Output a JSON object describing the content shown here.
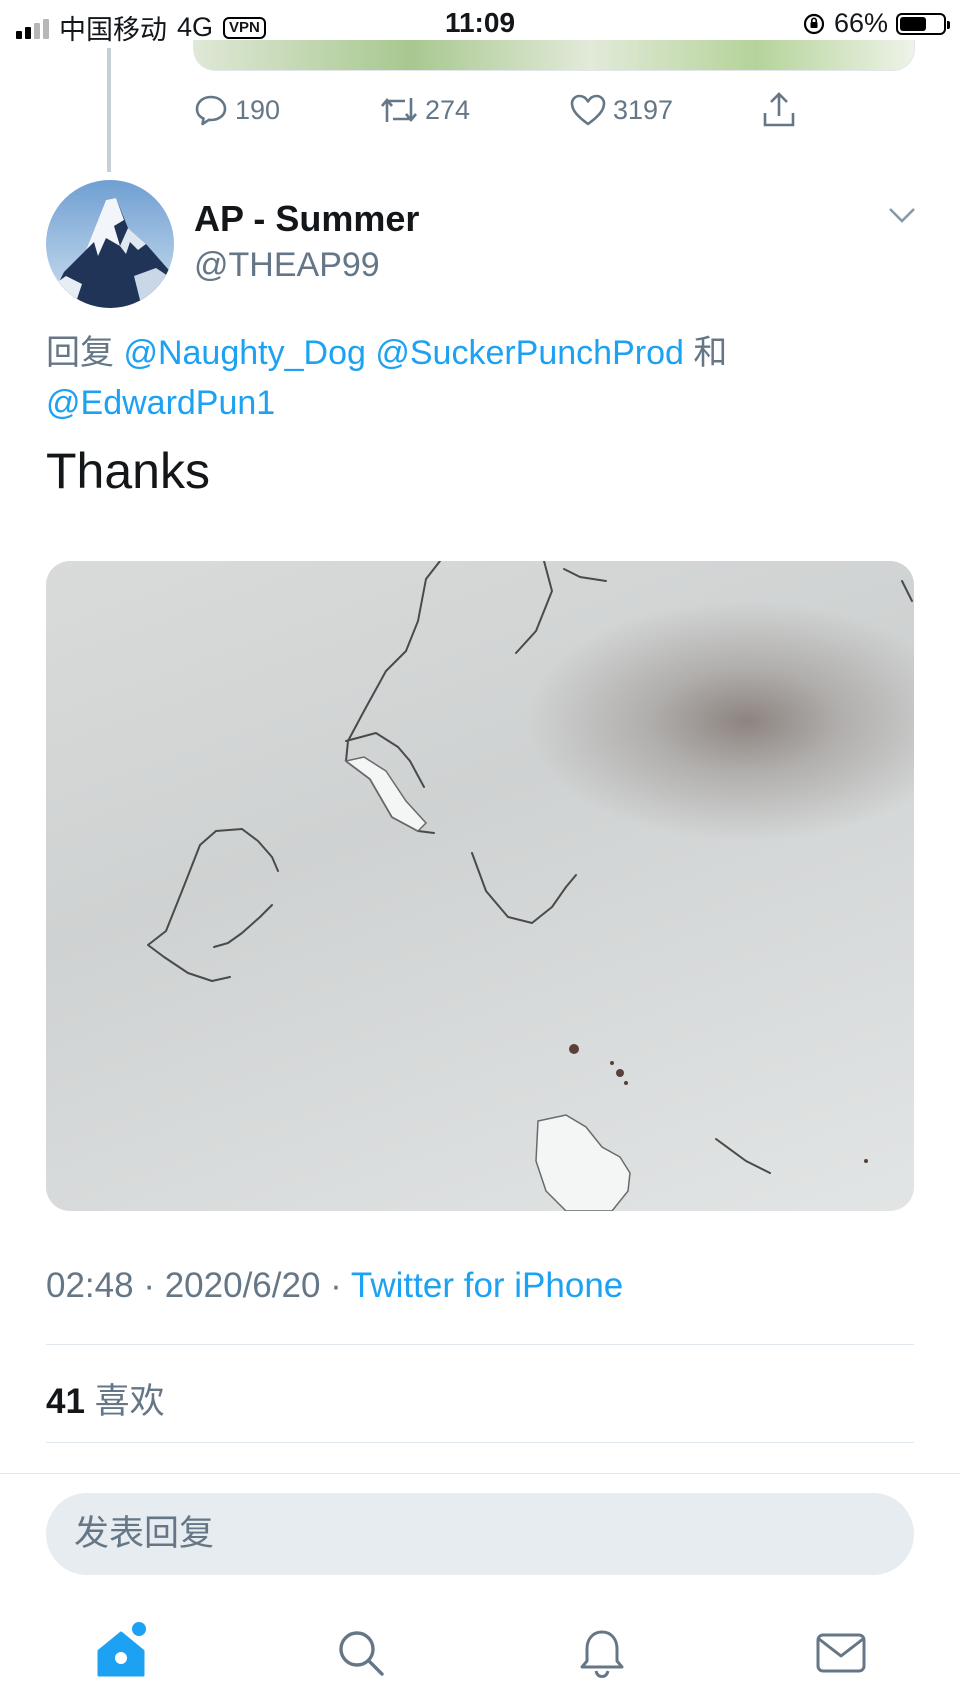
{
  "status_bar": {
    "carrier": "中国移动",
    "network": "4G",
    "vpn": "VPN",
    "time": "11:09",
    "battery": "66%",
    "battery_level": 0.66
  },
  "previous_tweet": {
    "replies": "190",
    "retweets": "274",
    "likes": "3197"
  },
  "tweet": {
    "author_name": "AP - Summer",
    "author_handle": "@THEAP99",
    "reply_prefix": "回复",
    "mention_1": "@Naughty_Dog",
    "mention_2": "@SuckerPunchProd",
    "reply_conjunction": "和",
    "mention_3": "@EdwardPun1",
    "text": "Thanks",
    "time": "02:48",
    "date": "2020/6/20",
    "separator": "·",
    "source": "Twitter for iPhone",
    "like_count": "41",
    "like_label": "喜欢"
  },
  "reply_box": {
    "placeholder": "发表回复"
  },
  "tab_bar": {
    "items": [
      "home-icon",
      "search-icon",
      "notifications-icon",
      "messages-icon"
    ],
    "accent": "#1da1f2",
    "inactive": "#657786"
  }
}
